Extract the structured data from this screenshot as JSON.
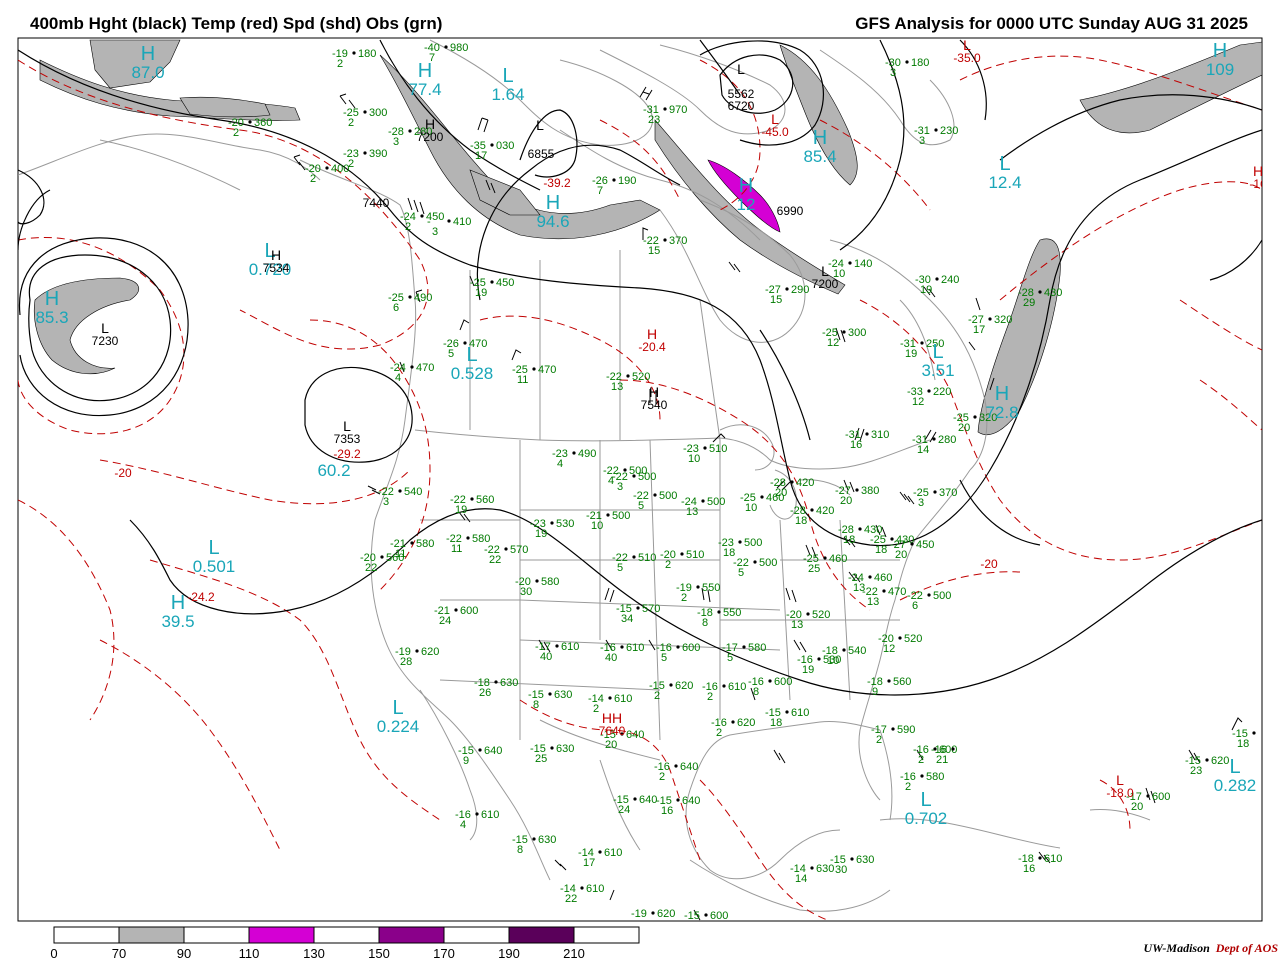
{
  "header": {
    "left_title": "400mb Hght (black) Temp (red) Spd (shd) Obs (grn)",
    "right_title": "GFS Analysis for 0000 UTC Sunday  AUG 31 2025"
  },
  "colors": {
    "height_contour": "#000000",
    "temp_contour": "#c00000",
    "speed_70_90": "#b4b4b4",
    "speed_110_130": "#d400d4",
    "speed_150_170": "#8a008a",
    "speed_190_210": "#5a005a",
    "observations": "#007a00",
    "max_min_labels": "#1aa6b8",
    "borders": "#9a9a9a"
  },
  "legend": {
    "ticks": [
      "0",
      "70",
      "90",
      "110",
      "130",
      "150",
      "170",
      "190",
      "210"
    ]
  },
  "credit": {
    "org": "UW-Madison",
    "dept": "Dept of AOS"
  },
  "centers": [
    {
      "id": "c1",
      "sym": "H",
      "value": "87.0",
      "color": "cyan"
    },
    {
      "id": "c2",
      "sym": "H",
      "value": "77.4",
      "color": "cyan"
    },
    {
      "id": "c3",
      "sym": "L",
      "value": "1.64",
      "color": "cyan"
    },
    {
      "id": "c4",
      "sym": "L",
      "value": "",
      "color": "black"
    },
    {
      "id": "c5",
      "sym": "",
      "value": "6855",
      "color": "black"
    },
    {
      "id": "c6",
      "sym": "L",
      "value": "",
      "color": "black"
    },
    {
      "id": "c7",
      "sym": "",
      "value": "5562",
      "color": "black"
    },
    {
      "id": "c8",
      "sym": "",
      "value": "6720",
      "color": "black"
    },
    {
      "id": "c9",
      "sym": "L",
      "value": "-45.0",
      "color": "red"
    },
    {
      "id": "c10",
      "sym": "H",
      "value": "85.4",
      "color": "cyan"
    },
    {
      "id": "c11",
      "sym": "H",
      "value": "94.6",
      "color": "cyan"
    },
    {
      "id": "c12",
      "sym": "H",
      "value": "12",
      "color": "cyan"
    },
    {
      "id": "c13",
      "sym": "",
      "value": "7440",
      "color": "black"
    },
    {
      "id": "c14",
      "sym": "L",
      "value": "0.720",
      "color": "cyan"
    },
    {
      "id": "c15",
      "sym": "H",
      "value": "7534",
      "color": "black"
    },
    {
      "id": "c16",
      "sym": "H",
      "value": "85.3",
      "color": "cyan"
    },
    {
      "id": "c17",
      "sym": "L",
      "value": "7230",
      "color": "black"
    },
    {
      "id": "c18",
      "sym": "L",
      "value": "0.528",
      "color": "cyan"
    },
    {
      "id": "c19",
      "sym": "H",
      "value": "-20.4",
      "color": "red"
    },
    {
      "id": "c20",
      "sym": "H",
      "value": "7540",
      "color": "black"
    },
    {
      "id": "c21",
      "sym": "L",
      "value": "7353",
      "color": "black"
    },
    {
      "id": "c22",
      "sym": "",
      "value": "-29.2",
      "color": "red"
    },
    {
      "id": "c23",
      "sym": "",
      "value": "60.2",
      "color": "cyan"
    },
    {
      "id": "c24",
      "sym": "L",
      "value": "0.501",
      "color": "cyan"
    },
    {
      "id": "c25",
      "sym": "",
      "value": "-24.2",
      "color": "red"
    },
    {
      "id": "c26",
      "sym": "H",
      "value": "39.5",
      "color": "cyan"
    },
    {
      "id": "c27",
      "sym": "L",
      "value": "0.224",
      "color": "cyan"
    },
    {
      "id": "c28",
      "sym": "HH",
      "value": "7640",
      "color": "red"
    },
    {
      "id": "c29",
      "sym": "L",
      "value": "12.4",
      "color": "cyan"
    },
    {
      "id": "c30",
      "sym": "H",
      "value": "109",
      "color": "cyan"
    },
    {
      "id": "c31",
      "sym": "L",
      "value": "-35.0",
      "color": "red"
    },
    {
      "id": "c32",
      "sym": "L",
      "value": "3.51",
      "color": "cyan"
    },
    {
      "id": "c33",
      "sym": "H",
      "value": "72.8",
      "color": "cyan"
    },
    {
      "id": "c34",
      "sym": "L",
      "value": "0.702",
      "color": "cyan"
    },
    {
      "id": "c35",
      "sym": "L",
      "value": "0.282",
      "color": "cyan"
    },
    {
      "id": "c36",
      "sym": "L",
      "value": "-18.0",
      "color": "red"
    },
    {
      "id": "c37",
      "sym": "L",
      "value": "7200",
      "color": "black"
    },
    {
      "id": "c38",
      "sym": "H",
      "value": "7200",
      "color": "black"
    },
    {
      "id": "c39",
      "sym": "",
      "value": "-20",
      "color": "red"
    },
    {
      "id": "c40",
      "sym": "",
      "value": "-20",
      "color": "red"
    },
    {
      "id": "c41",
      "sym": "",
      "value": "-39.2",
      "color": "red"
    },
    {
      "id": "c42",
      "sym": "",
      "value": "6990",
      "color": "black"
    },
    {
      "id": "c43",
      "sym": "H",
      "value": "-16",
      "color": "red"
    }
  ],
  "observations": [
    {
      "id": "o1",
      "t": "-19",
      "v": "180",
      "d": "2"
    },
    {
      "id": "o2",
      "t": "-40",
      "v": "980",
      "d": "7"
    },
    {
      "id": "o3",
      "t": "-20",
      "v": "360",
      "d": "2"
    },
    {
      "id": "o4",
      "t": "-25",
      "v": "300",
      "d": "2"
    },
    {
      "id": "o5",
      "t": "-28",
      "v": "280",
      "d": "3"
    },
    {
      "id": "o6",
      "t": "-23",
      "v": "390",
      "d": "2"
    },
    {
      "id": "o7",
      "t": "-20",
      "v": "400",
      "d": "2"
    },
    {
      "id": "o8",
      "t": "-35",
      "v": "030",
      "d": "17"
    },
    {
      "id": "o9",
      "t": "-31",
      "v": "970",
      "d": "23"
    },
    {
      "id": "o10",
      "t": "-26",
      "v": "190",
      "d": "7"
    },
    {
      "id": "o11",
      "t": "-24",
      "v": "450",
      "d": "2"
    },
    {
      "id": "o12",
      "t": "-",
      "v": "410",
      "d": "3"
    },
    {
      "id": "o13",
      "t": "-22",
      "v": "370",
      "d": "15"
    },
    {
      "id": "o14",
      "t": "-25",
      "v": "450",
      "d": "19"
    },
    {
      "id": "o15",
      "t": "-25",
      "v": "490",
      "d": "6"
    },
    {
      "id": "o16",
      "t": "-26",
      "v": "470",
      "d": "5"
    },
    {
      "id": "o17",
      "t": "-24",
      "v": "470",
      "d": "4"
    },
    {
      "id": "o18",
      "t": "-25",
      "v": "470",
      "d": "11"
    },
    {
      "id": "o19",
      "t": "-22",
      "v": "520",
      "d": "13"
    },
    {
      "id": "o20",
      "t": "-27",
      "v": "290",
      "d": "15"
    },
    {
      "id": "o21",
      "t": "-24",
      "v": "140",
      "d": "10"
    },
    {
      "id": "o22",
      "t": "-30",
      "v": "240",
      "d": "19"
    },
    {
      "id": "o23",
      "t": "-25",
      "v": "300",
      "d": "12"
    },
    {
      "id": "o24",
      "t": "-31",
      "v": "250",
      "d": "19"
    },
    {
      "id": "o25",
      "t": "-27",
      "v": "320",
      "d": "17"
    },
    {
      "id": "o26",
      "t": "-28",
      "v": "430",
      "d": "29"
    },
    {
      "id": "o27",
      "t": "-30",
      "v": "180",
      "d": "3"
    },
    {
      "id": "o28",
      "t": "-31",
      "v": "230",
      "d": "3"
    },
    {
      "id": "o29",
      "t": "-33",
      "v": "220",
      "d": "12"
    },
    {
      "id": "o30",
      "t": "-25",
      "v": "320",
      "d": "20"
    },
    {
      "id": "o31",
      "t": "-31",
      "v": "310",
      "d": "16"
    },
    {
      "id": "o32",
      "t": "-31",
      "v": "280",
      "d": "14"
    },
    {
      "id": "o33",
      "t": "-23",
      "v": "490",
      "d": "4"
    },
    {
      "id": "o34",
      "t": "-23",
      "v": "510",
      "d": "10"
    },
    {
      "id": "o35",
      "t": "-22",
      "v": "500",
      "d": "3"
    },
    {
      "id": "o36",
      "t": "-22",
      "v": "500",
      "d": "5"
    },
    {
      "id": "o37",
      "t": "-24",
      "v": "500",
      "d": "13"
    },
    {
      "id": "o38",
      "t": "-25",
      "v": "460",
      "d": "10"
    },
    {
      "id": "o39",
      "t": "-28",
      "v": "420",
      "d": "20"
    },
    {
      "id": "o40",
      "t": "-27",
      "v": "380",
      "d": "20"
    },
    {
      "id": "o41",
      "t": "-25",
      "v": "370",
      "d": "3"
    },
    {
      "id": "o42",
      "t": "-22",
      "v": "500",
      "d": "4"
    },
    {
      "id": "o43",
      "t": "-22",
      "v": "540",
      "d": "3"
    },
    {
      "id": "o44",
      "t": "-22",
      "v": "560",
      "d": "19"
    },
    {
      "id": "o45",
      "t": "-23",
      "v": "530",
      "d": "19"
    },
    {
      "id": "o46",
      "t": "-21",
      "v": "500",
      "d": "10"
    },
    {
      "id": "o47",
      "t": "-28",
      "v": "420",
      "d": "18"
    },
    {
      "id": "o48",
      "t": "-28",
      "v": "430",
      "d": "18"
    },
    {
      "id": "o49",
      "t": "-25",
      "v": "430",
      "d": "18"
    },
    {
      "id": "o50",
      "t": "-27",
      "v": "450",
      "d": "20"
    },
    {
      "id": "o51",
      "t": "-21",
      "v": "580",
      "d": "11"
    },
    {
      "id": "o52",
      "t": "-22",
      "v": "580",
      "d": "11"
    },
    {
      "id": "o53",
      "t": "-22",
      "v": "570",
      "d": "22"
    },
    {
      "id": "o54",
      "t": "-20",
      "v": "560",
      "d": "22"
    },
    {
      "id": "o55",
      "t": "-20",
      "v": "580",
      "d": "30"
    },
    {
      "id": "o56",
      "t": "-22",
      "v": "510",
      "d": "5"
    },
    {
      "id": "o57",
      "t": "-20",
      "v": "510",
      "d": "2"
    },
    {
      "id": "o58",
      "t": "-23",
      "v": "500",
      "d": "18"
    },
    {
      "id": "o59",
      "t": "-22",
      "v": "500",
      "d": "5"
    },
    {
      "id": "o60",
      "t": "-25",
      "v": "460",
      "d": "25"
    },
    {
      "id": "o61",
      "t": "-24",
      "v": "460",
      "d": "13"
    },
    {
      "id": "o62",
      "t": "-22",
      "v": "470",
      "d": "13"
    },
    {
      "id": "o63",
      "t": "-22",
      "v": "500",
      "d": "6"
    },
    {
      "id": "o64",
      "t": "-21",
      "v": "600",
      "d": "24"
    },
    {
      "id": "o65",
      "t": "-15",
      "v": "570",
      "d": "34"
    },
    {
      "id": "o66",
      "t": "-19",
      "v": "550",
      "d": "2"
    },
    {
      "id": "o67",
      "t": "-18",
      "v": "550",
      "d": "8"
    },
    {
      "id": "o68",
      "t": "-20",
      "v": "520",
      "d": "13"
    },
    {
      "id": "o69",
      "t": "-20",
      "v": "520",
      "d": "12"
    },
    {
      "id": "o70",
      "t": "-19",
      "v": "620",
      "d": "28"
    },
    {
      "id": "o71",
      "t": "-17",
      "v": "610",
      "d": "40"
    },
    {
      "id": "o72",
      "t": "-16",
      "v": "610",
      "d": "40"
    },
    {
      "id": "o73",
      "t": "-16",
      "v": "600",
      "d": "5"
    },
    {
      "id": "o74",
      "t": "-17",
      "v": "580",
      "d": "5"
    },
    {
      "id": "o75",
      "t": "-16",
      "v": "530",
      "d": "19"
    },
    {
      "id": "o76",
      "t": "-18",
      "v": "540",
      "d": "10"
    },
    {
      "id": "o77",
      "t": "-18",
      "v": "560",
      "d": "9"
    },
    {
      "id": "o78",
      "t": "-18",
      "v": "630",
      "d": "26"
    },
    {
      "id": "o79",
      "t": "-15",
      "v": "630",
      "d": "8"
    },
    {
      "id": "o80",
      "t": "-14",
      "v": "610",
      "d": "2"
    },
    {
      "id": "o81",
      "t": "-15",
      "v": "620",
      "d": "2"
    },
    {
      "id": "o82",
      "t": "-16",
      "v": "610",
      "d": "2"
    },
    {
      "id": "o83",
      "t": "-16",
      "v": "600",
      "d": "8"
    },
    {
      "id": "o84",
      "t": "-15",
      "v": "610",
      "d": "18"
    },
    {
      "id": "o85",
      "t": "-16",
      "v": "620",
      "d": "2"
    },
    {
      "id": "o86",
      "t": "-17",
      "v": "590",
      "d": "2"
    },
    {
      "id": "o87",
      "t": "-16",
      "v": "600",
      "d": "2"
    },
    {
      "id": "o88",
      "t": "-16",
      "v": "580",
      "d": "2"
    },
    {
      "id": "o89",
      "t": "-15",
      "v": "640",
      "d": "9"
    },
    {
      "id": "o90",
      "t": "-15",
      "v": "630",
      "d": "25"
    },
    {
      "id": "o91",
      "t": "-15",
      "v": "640",
      "d": "20"
    },
    {
      "id": "o92",
      "t": "-16",
      "v": "640",
      "d": "2"
    },
    {
      "id": "o93",
      "t": "-15",
      "v": "640",
      "d": "24"
    },
    {
      "id": "o94",
      "t": "-15",
      "v": "640",
      "d": "16"
    },
    {
      "id": "o95",
      "t": "-16",
      "v": "610",
      "d": "4"
    },
    {
      "id": "o96",
      "t": "-15",
      "v": "630",
      "d": "8"
    },
    {
      "id": "o97",
      "t": "-14",
      "v": "610",
      "d": "17"
    },
    {
      "id": "o98",
      "t": "-14",
      "v": "610",
      "d": "22"
    },
    {
      "id": "o99",
      "t": "-14",
      "v": "630",
      "d": "14"
    },
    {
      "id": "o100",
      "t": "-15",
      "v": "630",
      "d": "30"
    },
    {
      "id": "o101",
      "t": "-19",
      "v": "620",
      "d": ""
    },
    {
      "id": "o102",
      "t": "-15",
      "v": "600",
      "d": ""
    },
    {
      "id": "o103",
      "t": "-18",
      "v": "610",
      "d": "16"
    },
    {
      "id": "o104",
      "t": "-17",
      "v": "600",
      "d": "20"
    },
    {
      "id": "o105",
      "t": "-15",
      "v": "620",
      "d": "23"
    },
    {
      "id": "o106",
      "t": "-15",
      "v": "",
      "d": "18"
    },
    {
      "id": "o107",
      "t": "-16",
      "v": "",
      "d": "21"
    }
  ]
}
